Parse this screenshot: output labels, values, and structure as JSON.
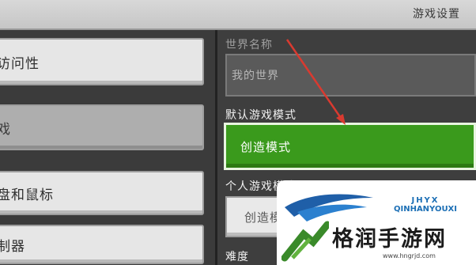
{
  "window": {
    "title": "游戏设置"
  },
  "sidebar": {
    "items": [
      {
        "label": "访问性"
      },
      {
        "label": "戏",
        "selected": true
      },
      {
        "label": "盘和鼠标"
      },
      {
        "label": "制器"
      }
    ]
  },
  "world_name": {
    "label": "世界名称",
    "value": "我的世界"
  },
  "default_mode": {
    "label": "默认游戏模式",
    "value": "创造模式"
  },
  "personal_mode": {
    "label": "个人游戏模式",
    "value": "创造模"
  },
  "difficulty": {
    "label": "难度"
  },
  "watermark": {
    "brand_top": "JHYX",
    "brand_bottom": "QINHANYOUXI",
    "site_name": "格润手游网",
    "url": "www.hngrjd.com"
  },
  "colors": {
    "accent": "#3a9a1c",
    "annotation_arrow": "#d93a30"
  }
}
